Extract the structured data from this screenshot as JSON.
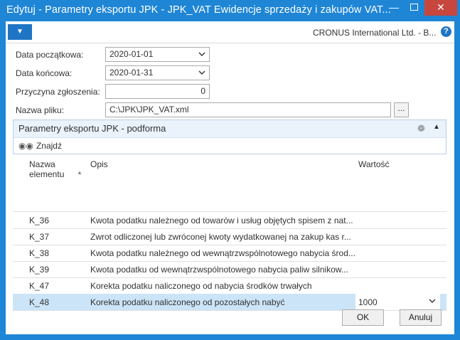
{
  "window": {
    "title": "Edytuj - Parametry eksportu JPK - JPK_VAT Ewidencje sprzedaży i zakupów VAT...",
    "minimize_glyph": "—",
    "close_glyph": "✕"
  },
  "actionbar": {
    "menu_glyph": "▼",
    "company": "CRONUS International Ltd. - B...",
    "help_glyph": "?"
  },
  "fields": {
    "start_date": {
      "label": "Data początkowa:",
      "value": "2020-01-01"
    },
    "end_date": {
      "label": "Data końcowa:",
      "value": "2020-01-31"
    },
    "reason": {
      "label": "Przyczyna zgłoszenia:",
      "value": "0"
    },
    "file_name": {
      "label": "Nazwa pliku:",
      "value": "C:\\JPK\\JPK_VAT.xml"
    },
    "browse_label": "..."
  },
  "subform": {
    "title": "Parametry eksportu JPK - podforma",
    "find_label": "Znajdź"
  },
  "grid": {
    "headers": {
      "name_line1": "Nazwa",
      "name_line2": "elementu",
      "description": "Opis",
      "value": "Wartość"
    },
    "rows": [
      {
        "name": "K_36",
        "description": "Kwota podatku należnego od towarów i usług objętych spisem z nat...",
        "value": ""
      },
      {
        "name": "K_37",
        "description": "Zwrot odliczonej lub zwróconej kwoty wydatkowanej na zakup kas r...",
        "value": ""
      },
      {
        "name": "K_38",
        "description": "Kwota podatku należnego od wewnątrzwspólnotowego nabycia środ...",
        "value": ""
      },
      {
        "name": "K_39",
        "description": "Kwota podatku od wewnątrzwspólnotowego nabycia paliw silnikow...",
        "value": ""
      },
      {
        "name": "K_47",
        "description": "Korekta podatku naliczonego od nabycia środków trwałych",
        "value": ""
      },
      {
        "name": "K_48",
        "description": "Korekta podatku naliczonego od pozostałych nabyć",
        "value": "1000"
      }
    ]
  },
  "buttons": {
    "ok": "OK",
    "cancel": "Anuluj"
  },
  "colors": {
    "titlebar": "#1f86d6",
    "close": "#c7463e",
    "selected_row": "#cce4f7",
    "subform_header": "#eaf2fb"
  }
}
